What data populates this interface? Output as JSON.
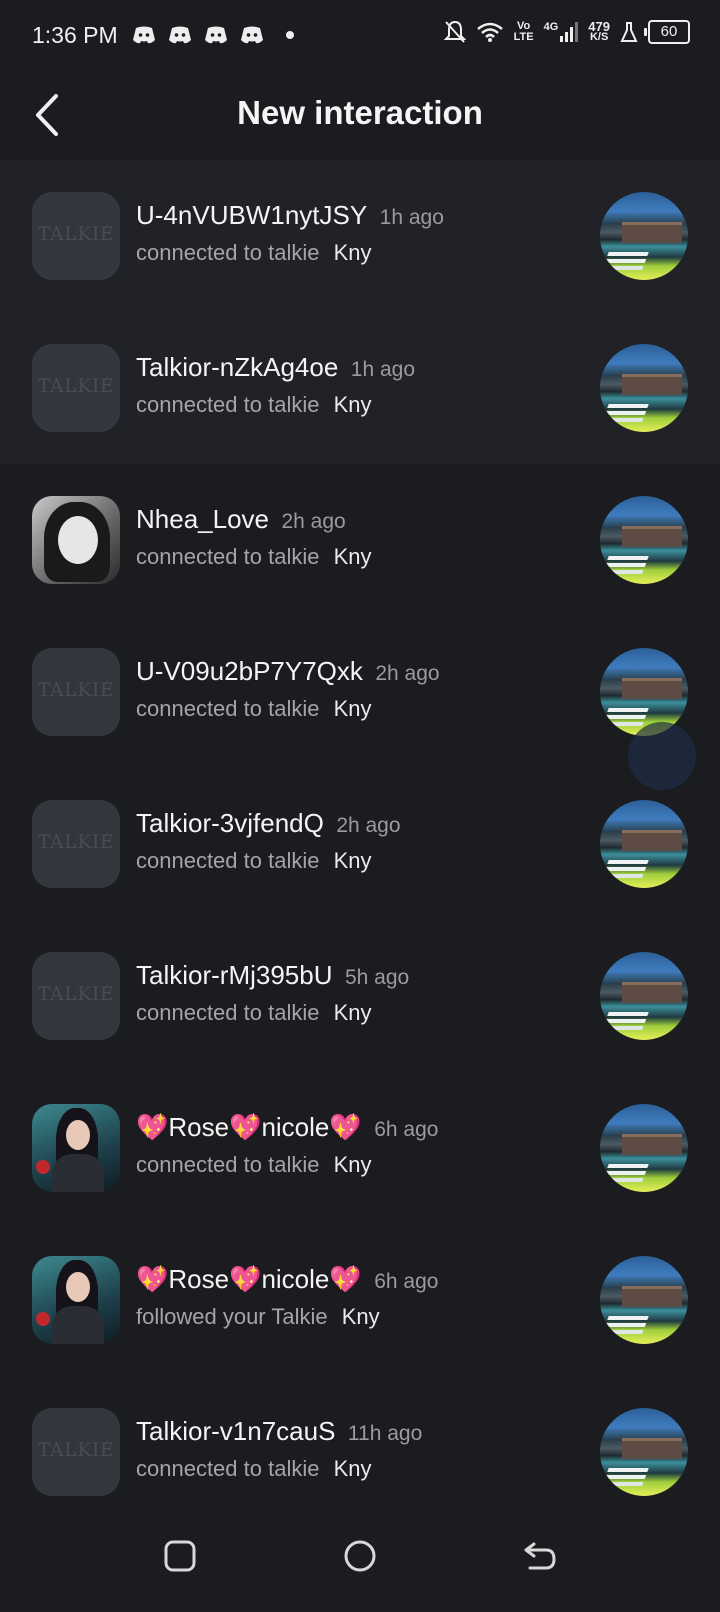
{
  "status_bar": {
    "time": "1:36 PM",
    "notifications": [
      "discord-icon",
      "discord-icon",
      "discord-icon",
      "discord-icon"
    ],
    "network": {
      "volte_top": "Vo",
      "volte_bottom": "LTE",
      "gen": "4G",
      "speed_top": "479",
      "speed_bottom": "K/S"
    },
    "battery": "60"
  },
  "header": {
    "title": "New interaction",
    "back_icon": "back-arrow-icon"
  },
  "items": [
    {
      "user": "U-4nVUBW1nytJSY",
      "time": "1h ago",
      "action": "connected to talkie",
      "target": "Kny",
      "avatar": "talkie-logo",
      "logo_text": "TALKIE",
      "highlight": true
    },
    {
      "user": "Talkior-nZkAg4oe",
      "time": "1h ago",
      "action": "connected to talkie",
      "target": "Kny",
      "avatar": "talkie-logo",
      "logo_text": "TALKIE",
      "highlight": true
    },
    {
      "user": "Nhea_Love",
      "time": "2h ago",
      "action": "connected to talkie",
      "target": "Kny",
      "avatar": "photo-bw",
      "logo_text": "",
      "highlight": false
    },
    {
      "user": "U-V09u2bP7Y7Qxk",
      "time": "2h ago",
      "action": "connected to talkie",
      "target": "Kny",
      "avatar": "talkie-logo",
      "logo_text": "TALKIE",
      "highlight": false
    },
    {
      "user": "Talkior-3vjfendQ",
      "time": "2h ago",
      "action": "connected to talkie",
      "target": "Kny",
      "avatar": "talkie-logo",
      "logo_text": "TALKIE",
      "highlight": false
    },
    {
      "user": "Talkior-rMj395bU",
      "time": "5h ago",
      "action": "connected to talkie",
      "target": "Kny",
      "avatar": "talkie-logo",
      "logo_text": "TALKIE",
      "highlight": false
    },
    {
      "user": "💖Rose💖nicole💖",
      "time": "6h ago",
      "action": "connected to talkie",
      "target": "Kny",
      "avatar": "photo-rose",
      "logo_text": "",
      "highlight": false
    },
    {
      "user": "💖Rose💖nicole💖",
      "time": "6h ago",
      "action": "followed your Talkie",
      "target": "Kny",
      "avatar": "photo-rose",
      "logo_text": "",
      "highlight": false
    },
    {
      "user": "Talkior-v1n7cauS",
      "time": "11h ago",
      "action": "connected to talkie",
      "target": "Kny",
      "avatar": "talkie-logo",
      "logo_text": "TALKIE",
      "highlight": false
    }
  ],
  "navbar": {
    "recents_icon": "recents-square-icon",
    "home_icon": "home-circle-icon",
    "back_icon": "back-gesture-icon"
  },
  "colors": {
    "background": "#1b1c20",
    "highlight_row": "#212228",
    "secondary_text": "#a4a5ab"
  }
}
